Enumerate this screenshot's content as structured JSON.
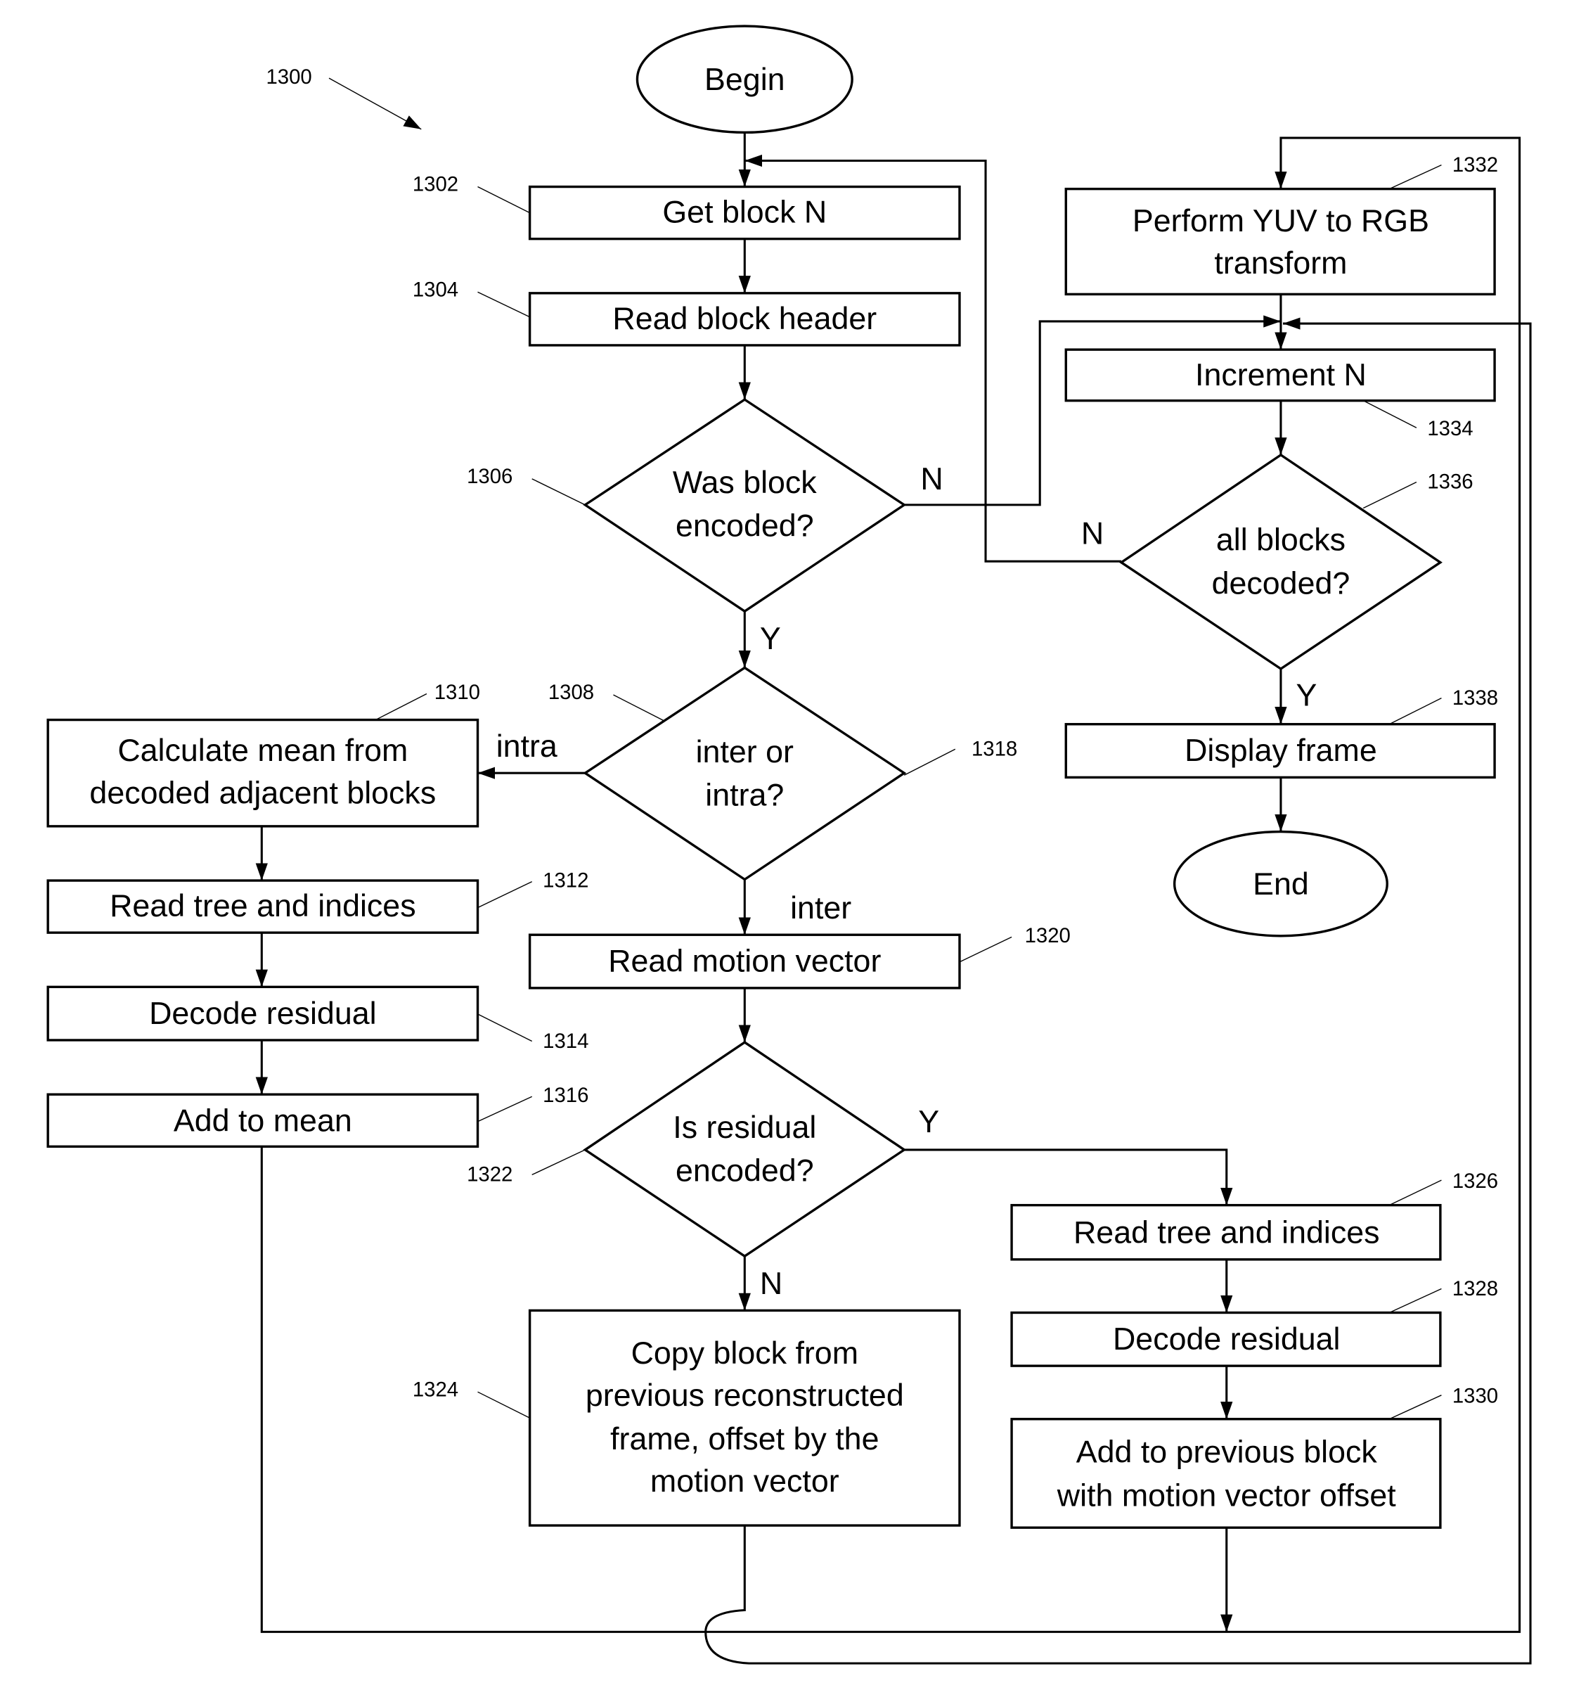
{
  "diagram": {
    "figure_ref": "1300",
    "nodes": {
      "begin": {
        "label": "Begin",
        "shape": "ellipse"
      },
      "n1302": {
        "ref": "1302",
        "lines": [
          "Get block N"
        ],
        "shape": "process"
      },
      "n1304": {
        "ref": "1304",
        "lines": [
          "Read block header"
        ],
        "shape": "process"
      },
      "n1306": {
        "ref": "1306",
        "lines": [
          "Was block",
          "encoded?"
        ],
        "shape": "decision"
      },
      "n1308": {
        "ref": "1308",
        "lines": [
          "inter or",
          "intra?"
        ],
        "shape": "decision"
      },
      "n1310": {
        "ref": "1310",
        "lines": [
          "Calculate mean from",
          "decoded adjacent blocks"
        ],
        "shape": "process"
      },
      "n1312": {
        "ref": "1312",
        "lines": [
          "Read tree and indices"
        ],
        "shape": "process"
      },
      "n1314": {
        "ref": "1314",
        "lines": [
          "Decode residual"
        ],
        "shape": "process"
      },
      "n1316": {
        "ref": "1316",
        "lines": [
          "Add to mean"
        ],
        "shape": "process"
      },
      "n1318": {
        "ref": "1318"
      },
      "n1320": {
        "ref": "1320",
        "lines": [
          "Read motion vector"
        ],
        "shape": "process"
      },
      "n1322": {
        "ref": "1322",
        "lines": [
          "Is residual",
          "encoded?"
        ],
        "shape": "decision"
      },
      "n1324": {
        "ref": "1324",
        "lines": [
          "Copy block from",
          "previous reconstructed",
          "frame, offset by the",
          "motion vector"
        ],
        "shape": "process"
      },
      "n1326": {
        "ref": "1326",
        "lines": [
          "Read tree and indices"
        ],
        "shape": "process"
      },
      "n1328": {
        "ref": "1328",
        "lines": [
          "Decode residual"
        ],
        "shape": "process"
      },
      "n1330": {
        "ref": "1330",
        "lines": [
          "Add to previous block",
          "with motion vector offset"
        ],
        "shape": "process"
      },
      "n1332": {
        "ref": "1332",
        "lines": [
          "Perform YUV to RGB",
          "transform"
        ],
        "shape": "process"
      },
      "n1334": {
        "ref": "1334",
        "lines": [
          "Increment N"
        ],
        "shape": "process"
      },
      "n1336": {
        "ref": "1336",
        "lines": [
          "all blocks",
          "decoded?"
        ],
        "shape": "decision"
      },
      "n1338": {
        "ref": "1338",
        "lines": [
          "Display frame"
        ],
        "shape": "process"
      },
      "end": {
        "label": "End",
        "shape": "ellipse"
      }
    },
    "edge_labels": {
      "n1306_no": "N",
      "n1306_yes": "Y",
      "n1308_intra": "intra",
      "n1308_inter": "inter",
      "n1322_yes": "Y",
      "n1322_no": "N",
      "n1336_no": "N",
      "n1336_yes": "Y"
    },
    "edges": [
      {
        "from": "begin",
        "to": "n1302"
      },
      {
        "from": "n1302",
        "to": "n1304"
      },
      {
        "from": "n1304",
        "to": "n1306"
      },
      {
        "from": "n1306",
        "to": "n1308",
        "label": "Y"
      },
      {
        "from": "n1306",
        "to": "n1334",
        "label": "N"
      },
      {
        "from": "n1308",
        "to": "n1310",
        "label": "intra"
      },
      {
        "from": "n1308",
        "to": "n1320",
        "label": "inter"
      },
      {
        "from": "n1310",
        "to": "n1312"
      },
      {
        "from": "n1312",
        "to": "n1314"
      },
      {
        "from": "n1314",
        "to": "n1316"
      },
      {
        "from": "n1316",
        "to": "n1332"
      },
      {
        "from": "n1320",
        "to": "n1322"
      },
      {
        "from": "n1322",
        "to": "n1326",
        "label": "Y"
      },
      {
        "from": "n1322",
        "to": "n1324",
        "label": "N"
      },
      {
        "from": "n1326",
        "to": "n1328"
      },
      {
        "from": "n1328",
        "to": "n1330"
      },
      {
        "from": "n1330",
        "to": "n1332"
      },
      {
        "from": "n1324",
        "to": "n1334"
      },
      {
        "from": "n1332",
        "to": "n1334"
      },
      {
        "from": "n1334",
        "to": "n1336"
      },
      {
        "from": "n1336",
        "to": "n1302",
        "label": "N"
      },
      {
        "from": "n1336",
        "to": "n1338",
        "label": "Y"
      },
      {
        "from": "n1338",
        "to": "end"
      }
    ]
  }
}
